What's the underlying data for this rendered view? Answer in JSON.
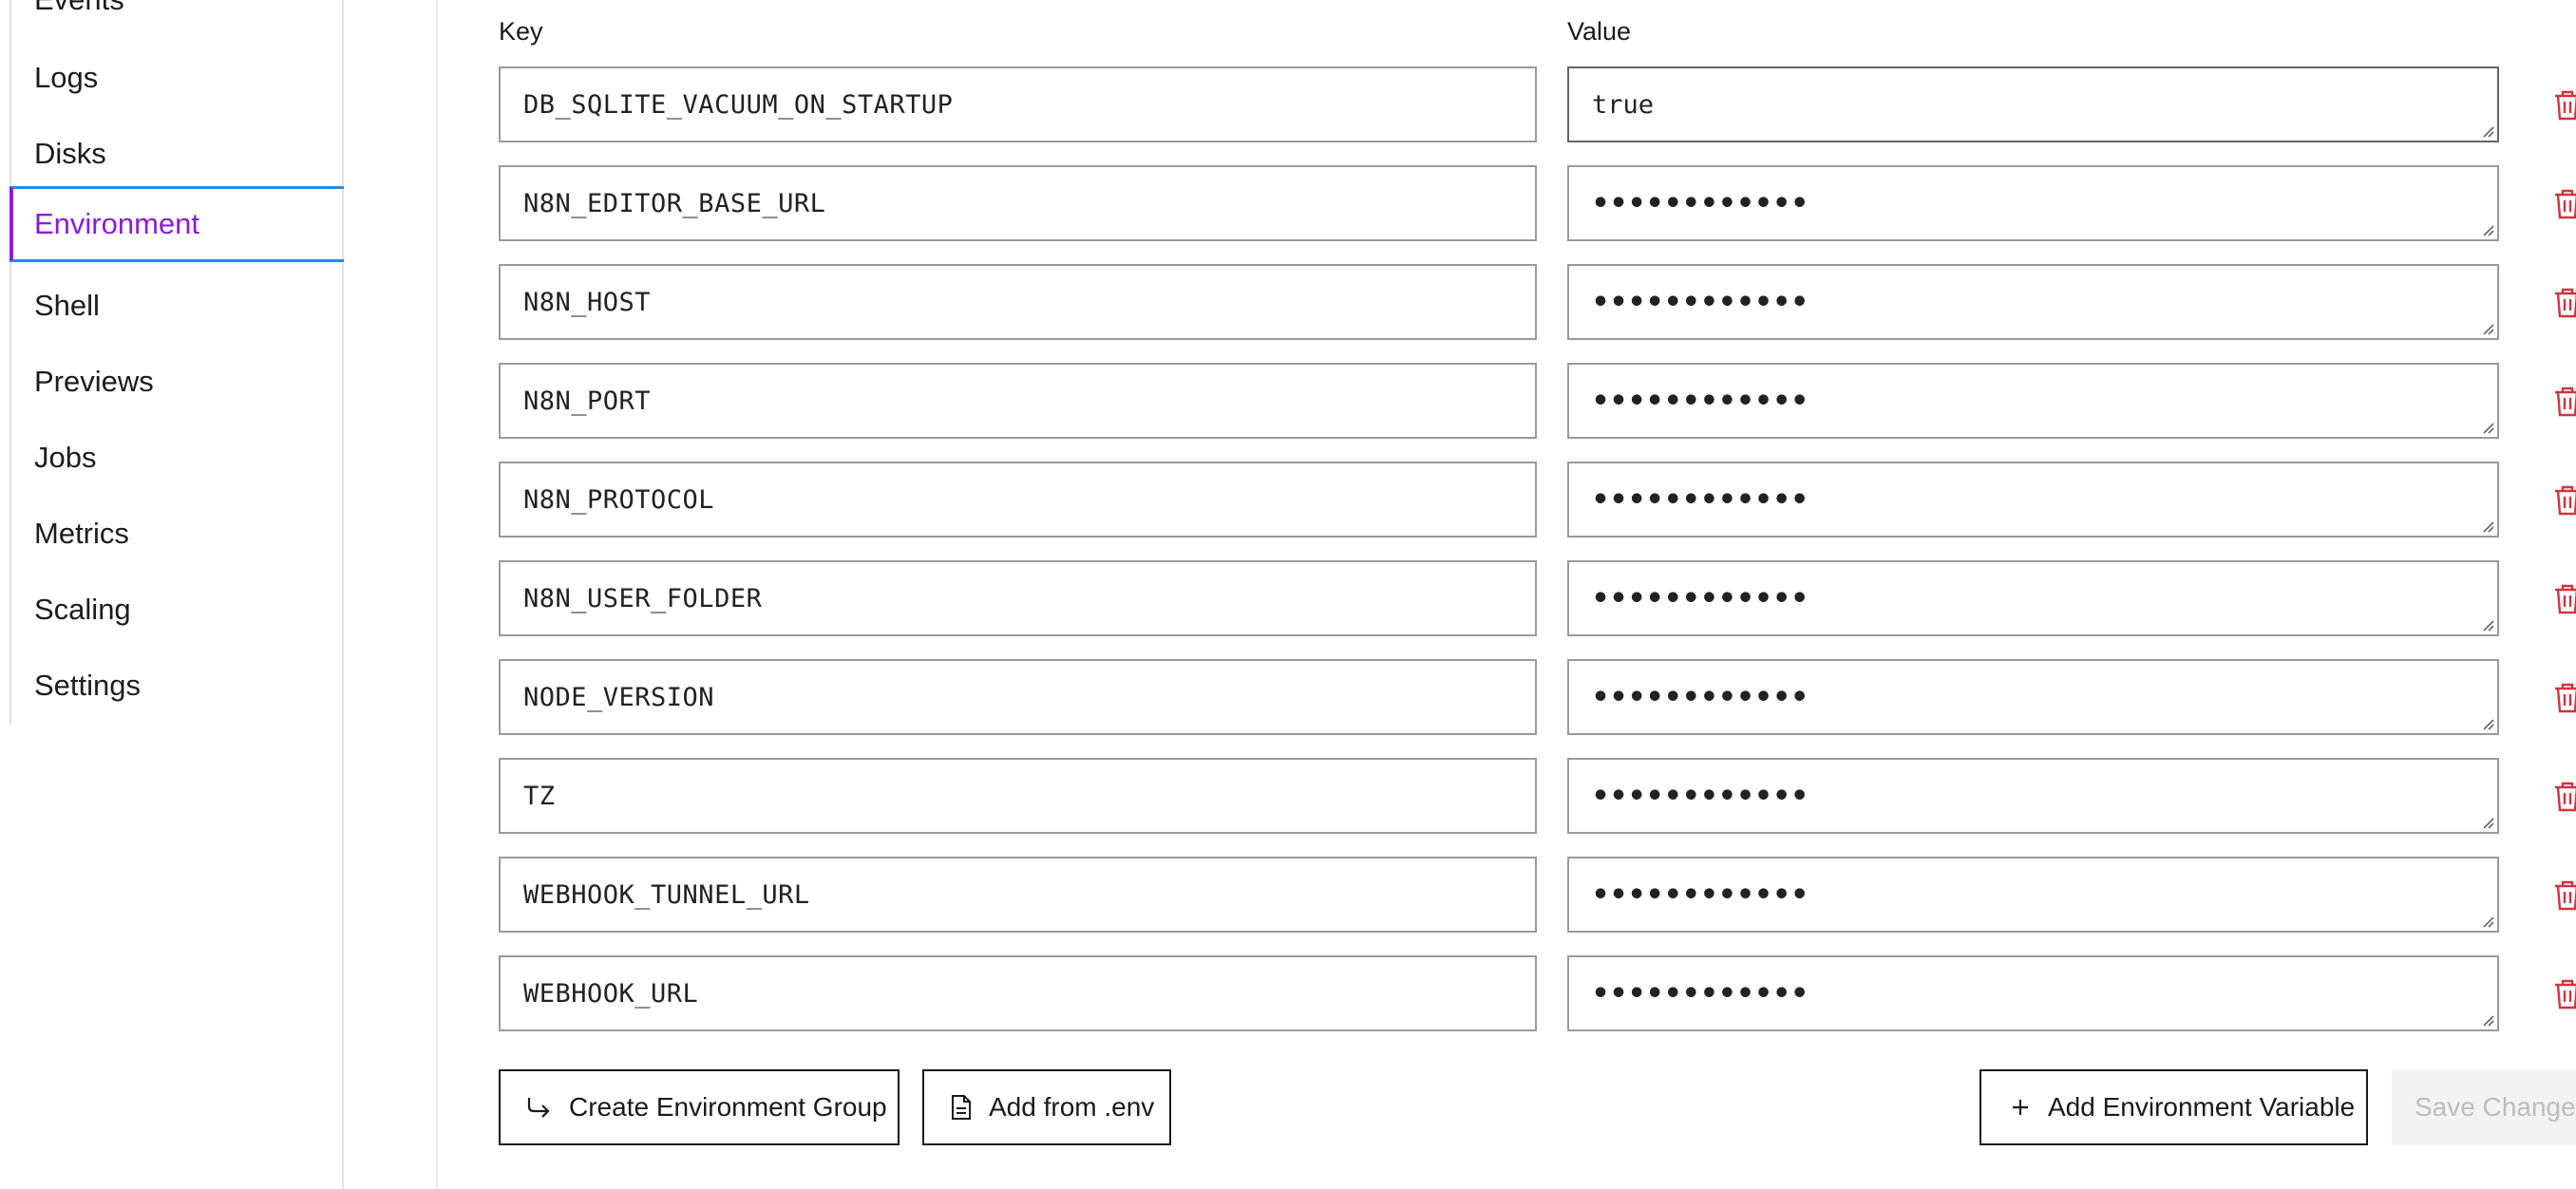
{
  "sidebar": {
    "items": [
      {
        "label": "Events",
        "active": false
      },
      {
        "label": "Logs",
        "active": false
      },
      {
        "label": "Disks",
        "active": false
      },
      {
        "label": "Environment",
        "active": true
      },
      {
        "label": "Shell",
        "active": false
      },
      {
        "label": "Previews",
        "active": false
      },
      {
        "label": "Jobs",
        "active": false
      },
      {
        "label": "Metrics",
        "active": false
      },
      {
        "label": "Scaling",
        "active": false
      },
      {
        "label": "Settings",
        "active": false
      }
    ]
  },
  "env": {
    "key_header": "Key",
    "value_header": "Value",
    "rows": [
      {
        "key": "DB_SQLITE_VACUUM_ON_STARTUP",
        "value": "true"
      },
      {
        "key": "N8N_EDITOR_BASE_URL",
        "value": "••••••••••••"
      },
      {
        "key": "N8N_HOST",
        "value": "••••••••••••"
      },
      {
        "key": "N8N_PORT",
        "value": "••••••••••••"
      },
      {
        "key": "N8N_PROTOCOL",
        "value": "••••••••••••"
      },
      {
        "key": "N8N_USER_FOLDER",
        "value": "••••••••••••"
      },
      {
        "key": "NODE_VERSION",
        "value": "••••••••••••"
      },
      {
        "key": "TZ",
        "value": "••••••••••••"
      },
      {
        "key": "WEBHOOK_TUNNEL_URL",
        "value": "••••••••••••"
      },
      {
        "key": "WEBHOOK_URL",
        "value": "••••••••••••"
      }
    ]
  },
  "actions": {
    "create_group_label": "Create Environment Group",
    "add_from_env_label": "Add from .env",
    "add_variable_label": "Add Environment Variable",
    "save_label": "Save Changes"
  },
  "icons": {
    "create_group": "arrow-return-icon",
    "add_from_env": "file-icon",
    "add_variable": "plus-icon",
    "delete": "trash-icon"
  },
  "colors": {
    "active_nav": "#8a1ed6",
    "active_nav_border": "#2d88e2",
    "delete": "#d0343f"
  }
}
